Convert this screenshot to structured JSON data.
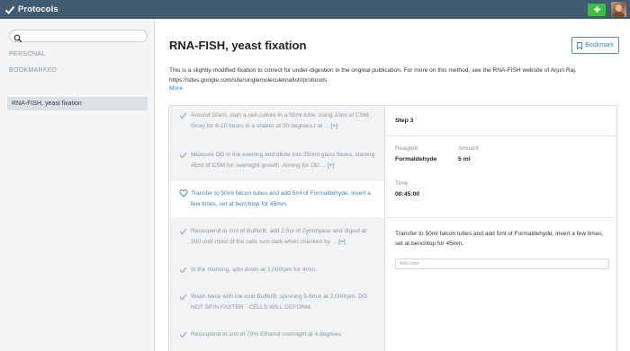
{
  "app": {
    "name": "Protocols",
    "accent": "#3f5c73",
    "add_color": "#3fbf3f",
    "link_color": "#3c80bf"
  },
  "sidebar": {
    "search_placeholder": "",
    "sections": [
      "PERSONAL",
      "BOOKMARKED"
    ],
    "bookmarked_items": [
      "RNA-FISH, yeast fixation"
    ]
  },
  "protocol": {
    "title": "RNA-FISH, yeast fixation",
    "bookmark_label": "Bookmark",
    "description": "This is a slightly-modified fixation to correct for under-digestion in the original publication. For more on this method, see the RNA-FISH website of Arjun Raj. https://sites.google.com/site/singlemoleculernafish/protocols",
    "more_label": "More"
  },
  "steps": [
    {
      "text": "Around 10am, start a cell culture in a 50ml tube, using 10ml of CSM. Grow for 8-10 hours in a shaker at 30 degrees.r at ...",
      "expand": "[+]",
      "active": false
    },
    {
      "text": "Measure OD in the evening and dilute into 250ml glass flasks, starting 45ml of CSM for overnight growth. Aiming for OD ...",
      "expand": "[+]",
      "active": false
    },
    {
      "text": "Transfer to 50ml falcon tubes and add 5ml of Formaldehyde, invert a few times, set at benchtop for 45min.",
      "expand": "",
      "active": true
    },
    {
      "text": "Resuspend in 1ml of BufferB, add 2.5ul of Zymolyase and digest at 300 until most of the cells turn dark when checked by ...",
      "expand": "[+]",
      "active": false
    },
    {
      "text": "In the morning, spin down at 3,000rpm for 4min.",
      "expand": "",
      "active": false
    },
    {
      "text": "Wash twice with ice-cold BufferB, spinning 5-6min at 2,000rpm. DO NOT SPIN FASTER - CELLS WILL DEFORM.",
      "expand": "",
      "active": false
    },
    {
      "text": "Resuspend in 1ml of 70% Ethanol overnight at 4 degrees.",
      "expand": "",
      "active": false
    }
  ],
  "step_detail": {
    "heading": "Step 3",
    "reagent_label": "Reagent",
    "reagent_value": "Formaldehyde",
    "amount_label": "Amount",
    "amount_value": "5 ml",
    "time_label": "Time",
    "time_value": "00:45:00",
    "text": "Transfer to 50ml falcon tubes and add 5ml of Formaldehyde, invert a few times, set at benchtop for 45min.",
    "note_placeholder": "Add note"
  }
}
